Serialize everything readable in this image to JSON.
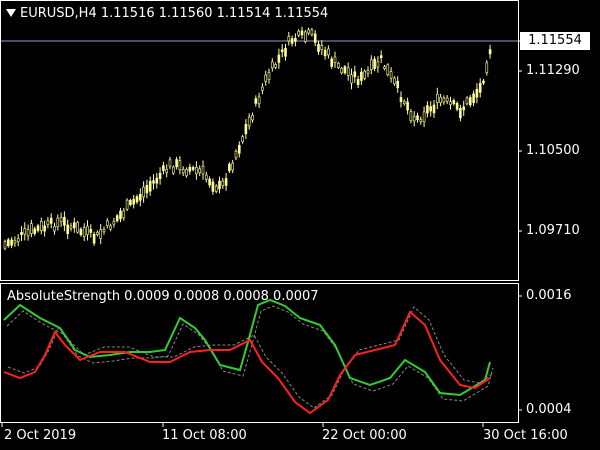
{
  "chart_window": {
    "symbol_line": "EURUSD,H4  1.11516 1.11560 1.11514 1.11554",
    "current_price_label": "1.11554",
    "price_axis": [
      "1.11290",
      "1.10500",
      "1.09710"
    ],
    "indicator_title": "AbsoluteStrength 0.0009 0.0008 0.0008 0.0007",
    "indicator_axis": [
      "0.0016",
      "0.0004"
    ],
    "time_axis": [
      "2 Oct 2019",
      "11 Oct 08:00",
      "22 Oct 00:00",
      "30 Oct 16:00"
    ],
    "colors": {
      "background": "#000000",
      "candles": "#ffff99",
      "grid_border": "#ffffff",
      "price_line": "#9999cc",
      "bull_line": "#33cc33",
      "bear_line": "#ff2020",
      "signal_lines": "#888888"
    }
  }
}
